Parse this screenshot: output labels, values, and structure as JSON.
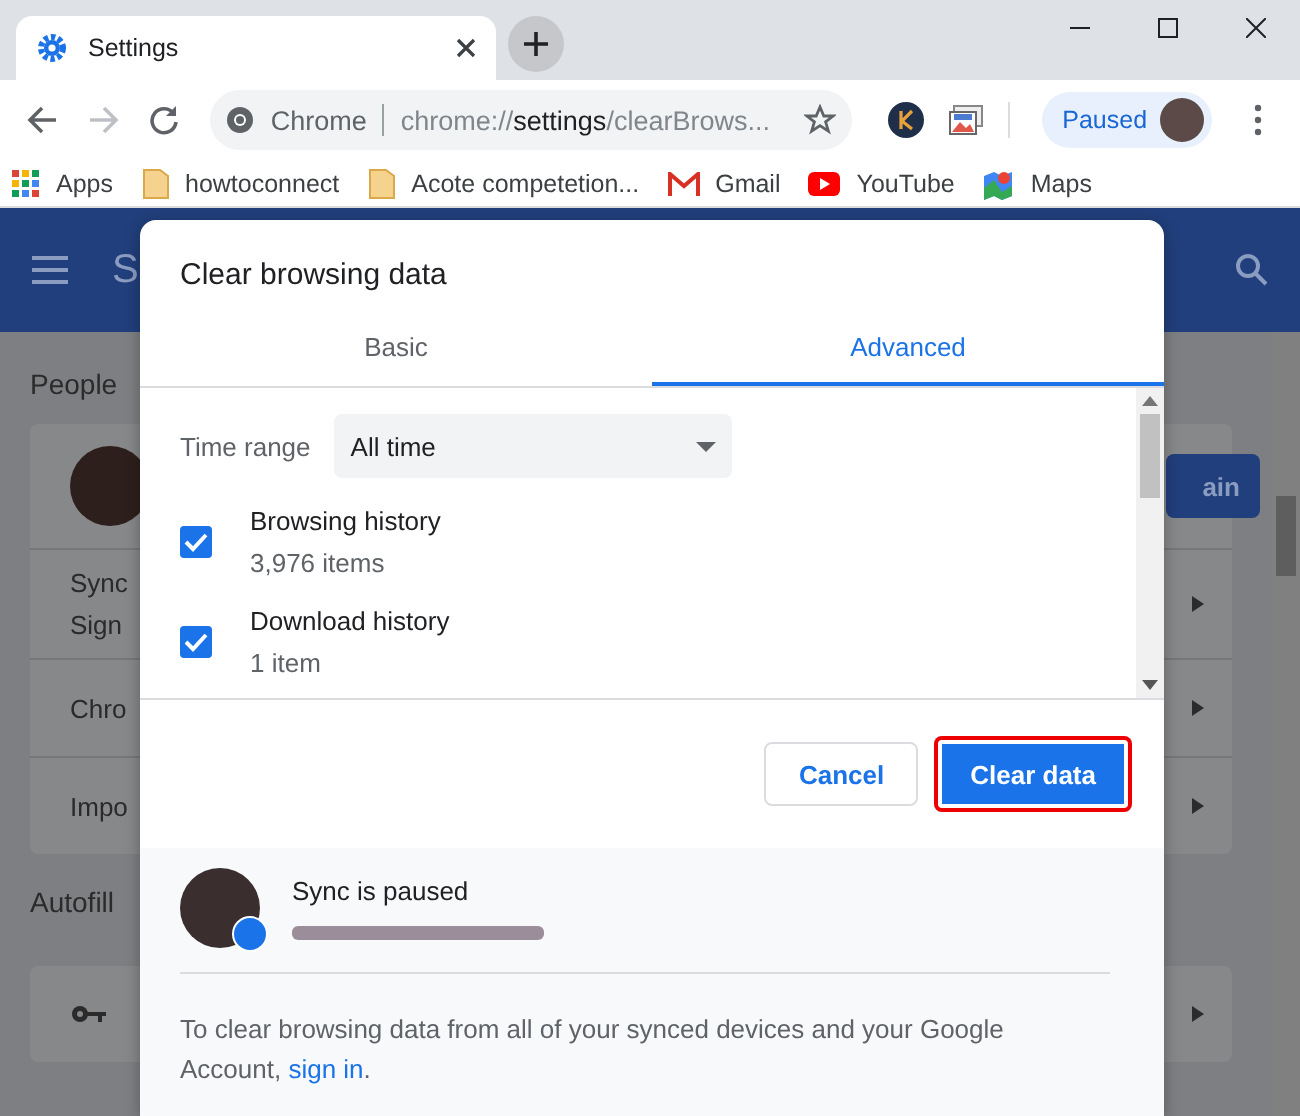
{
  "browser": {
    "tab": {
      "title": "Settings"
    },
    "omnibox": {
      "site": "Chrome",
      "url": [
        {
          "text": "chrome://",
          "emphasis": false
        },
        {
          "text": "settings",
          "emphasis": true
        },
        {
          "text": "/clearBrows...",
          "emphasis": false
        }
      ]
    },
    "profile": {
      "label": "Paused"
    },
    "bookmarks": [
      {
        "label": "Apps",
        "kind": "apps"
      },
      {
        "label": "howtoconnect",
        "kind": "folder"
      },
      {
        "label": "Acote competetion...",
        "kind": "folder"
      },
      {
        "label": "Gmail",
        "kind": "gmail"
      },
      {
        "label": "YouTube",
        "kind": "youtube"
      },
      {
        "label": "Maps",
        "kind": "maps"
      }
    ]
  },
  "settings_page": {
    "header_title": "S",
    "sections": [
      {
        "title": "People",
        "button": "ain",
        "rows": [
          "Sync",
          "Sign",
          "Chro",
          "Impo"
        ]
      },
      {
        "title": "Autofill"
      }
    ]
  },
  "dialog": {
    "title": "Clear browsing data",
    "tabs": [
      {
        "label": "Basic",
        "selected": false
      },
      {
        "label": "Advanced",
        "selected": true
      }
    ],
    "time_range": {
      "label": "Time range",
      "value": "All time"
    },
    "items": [
      {
        "label": "Browsing history",
        "detail": "3,976 items",
        "checked": true
      },
      {
        "label": "Download history",
        "detail": "1 item",
        "checked": true
      }
    ],
    "buttons": [
      {
        "label": "Cancel",
        "kind": "secondary",
        "highlighted": false
      },
      {
        "label": "Clear data",
        "kind": "primary",
        "highlighted": true
      }
    ],
    "sync": {
      "status": "Sync is paused",
      "message": "To clear browsing data from all of your synced devices and your Google Account,",
      "link": "sign in",
      "suffix": "."
    }
  }
}
